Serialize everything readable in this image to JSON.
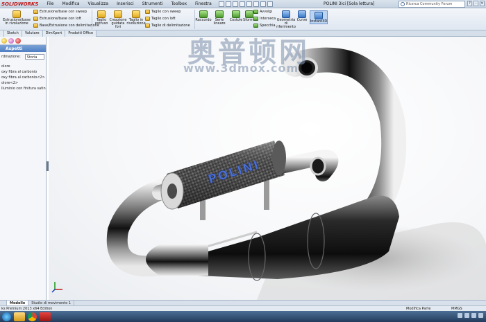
{
  "app": {
    "logo": "SOLIDWORKS",
    "doc_title": "POLINI 3ici [Sola lettura]",
    "menu": [
      "File",
      "Modifica",
      "Visualizza",
      "Inserisci",
      "Strumenti",
      "Toolbox",
      "Finestra"
    ]
  },
  "search": {
    "placeholder": "Ricerca Community Forum"
  },
  "ribbon": {
    "b0": "Estrusione/base in rivoluzione",
    "s1": "Estrusione/base con sweep",
    "s2": "Estrusione/base con loft",
    "s3": "Base/Estrusione con delimitazione",
    "b4": "Taglio estruso",
    "b5": "Creazione guidata fori",
    "b6": "Taglio in rivoluzione",
    "s7": "Taglio con sweep",
    "s8": "Taglio con loft",
    "s9": "Taglio di delimitazione",
    "b10": "Raccordo",
    "b11": "Serie lineare",
    "b12": "Costole",
    "b13": "Sformo",
    "s14": "Avvolgi",
    "s15": "Interseca",
    "s16": "Specchia",
    "b17": "Geometria di riferimento",
    "b18": "Curve",
    "b19": "Instant3D"
  },
  "tabs": [
    "Sketch",
    "Valutare",
    "DimXpert",
    "Prodotti Office"
  ],
  "panel": {
    "title": "Aspetti",
    "ordination_label": "rdinazione:",
    "ordination_value": "Storia",
    "items": [
      "olore",
      "oxy fibra al carbonio",
      "oxy fibra al carbonio<2>",
      "olore<2>",
      "lluminio con finitura satinata"
    ]
  },
  "model": {
    "label": "POLINI"
  },
  "watermark": {
    "cn": "奥普顿网",
    "url": "www.3dmox.com"
  },
  "bottom_tabs": [
    "Modello",
    "Studio di movimento 1"
  ],
  "status": {
    "left": "ks Premium 2013 x64 Edition",
    "mode": "Modifica Parte",
    "units": "MMGS"
  },
  "colors": {
    "accent": "#4e7fc3",
    "logo": "#c01515"
  }
}
